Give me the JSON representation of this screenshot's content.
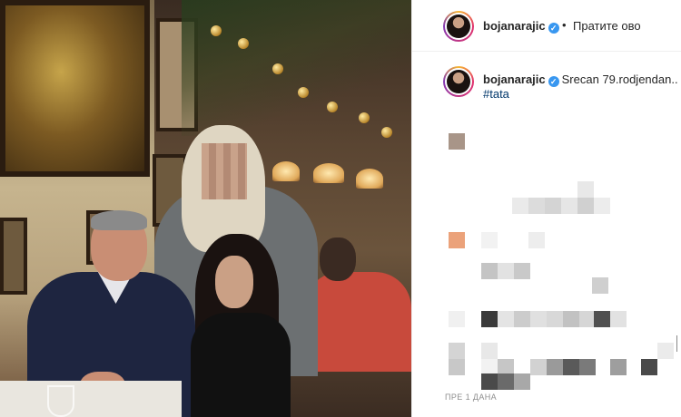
{
  "post": {
    "username": "bojanarajic",
    "verified_glyph": "✓",
    "separator": "•",
    "follow_label": "Пратите ово",
    "caption": "Srecan 79.rodjendan..",
    "hashtag": "#tata",
    "timestamp": "ПРЕ 1 ДАНА"
  },
  "icons": {
    "avatar": "profile-avatar",
    "verified": "verified-badge-icon"
  },
  "colors": {
    "verified": "#3897f0",
    "hashtag": "#00376b",
    "timestamp": "#8e8e8e",
    "border": "#efefef"
  }
}
